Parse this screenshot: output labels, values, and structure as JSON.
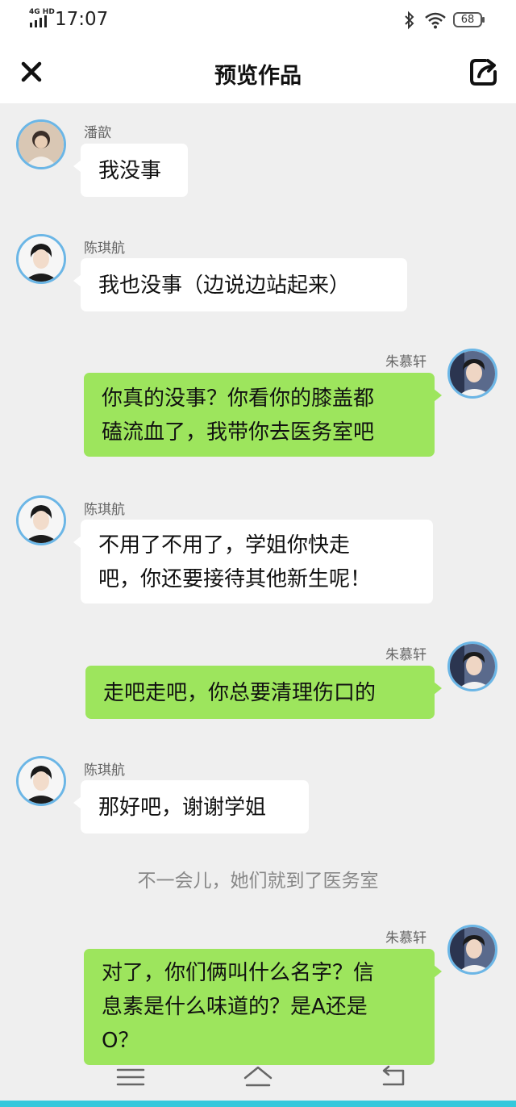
{
  "status_bar": {
    "network": "4G HD",
    "time": "17:07",
    "battery": "68"
  },
  "header": {
    "title": "预览作品"
  },
  "chat": {
    "messages": [
      {
        "sender": "潘歆",
        "text": "我没事",
        "side": "left"
      },
      {
        "sender": "陈琪航",
        "text": "我也没事（边说边站起来）",
        "side": "left"
      },
      {
        "sender": "朱慕轩",
        "lines": [
          "你真的没事？你看你的膝盖都",
          "磕流血了，我带你去医务室吧"
        ],
        "side": "right"
      },
      {
        "sender": "陈琪航",
        "lines": [
          "不用了不用了，学姐你快走",
          "吧，你还要接待其他新生呢！"
        ],
        "side": "left"
      },
      {
        "sender": "朱慕轩",
        "text": "走吧走吧，你总要清理伤口的",
        "side": "right"
      },
      {
        "sender": "陈琪航",
        "text": "那好吧，谢谢学姐",
        "side": "left"
      },
      {
        "sender": "朱慕轩",
        "lines": [
          "对了，你们俩叫什么名字？信",
          "息素是什么味道的？是A还是",
          "O？"
        ],
        "side": "right"
      }
    ],
    "narration": "不一会儿，她们就到了医务室"
  },
  "colors": {
    "bubble_green": "#9de55d",
    "bubble_white": "#ffffff",
    "avatar_ring": "#6bb6e6",
    "background": "#efefef"
  },
  "icons": {
    "close": "close-icon",
    "share": "share-icon",
    "menu": "menu-icon",
    "home": "home-icon",
    "back": "back-icon"
  }
}
